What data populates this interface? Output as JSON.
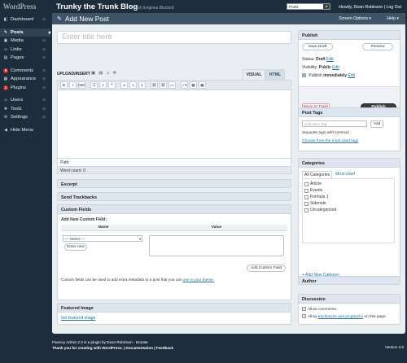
{
  "logo": "WordPress",
  "menu": [
    {
      "label": "Dashboard",
      "icon": "dashboard-icon",
      "glyph": "◧",
      "hint": "⊞",
      "active": false
    },
    {
      "label": "Posts",
      "icon": "pin-icon",
      "glyph": "✎",
      "hint": "",
      "active": true
    },
    {
      "label": "Media",
      "icon": "media-icon",
      "glyph": "▣",
      "hint": "⊞",
      "active": false
    },
    {
      "label": "Links",
      "icon": "link-icon",
      "glyph": "∞",
      "hint": "⊞",
      "active": false
    },
    {
      "label": "Pages",
      "icon": "pages-icon",
      "glyph": "▤",
      "hint": "⊞",
      "active": false
    },
    {
      "label": "Comments",
      "icon": "comments-badge-icon",
      "glyph": "0",
      "hint": "⊞",
      "active": false,
      "badge": true
    },
    {
      "label": "Appearance",
      "icon": "appearance-icon",
      "glyph": "▦",
      "hint": "⊞",
      "active": false
    },
    {
      "label": "Plugins",
      "icon": "plugins-badge-icon",
      "glyph": "1",
      "hint": "⊞",
      "active": false,
      "badge": true
    },
    {
      "label": "Users",
      "icon": "users-icon",
      "glyph": "☺",
      "hint": "⊞",
      "active": false
    },
    {
      "label": "Tools",
      "icon": "tools-icon",
      "glyph": "✚",
      "hint": "⊞",
      "active": false
    },
    {
      "label": "Settings",
      "icon": "settings-icon",
      "glyph": "⚙",
      "hint": "⊞",
      "active": false
    }
  ],
  "hide_menu": "Hide Menu",
  "topbar": {
    "site_title": "Trunky the Trunk Blog",
    "seo_status": "Search Engines Blocked",
    "post_select": "Posts",
    "howdy": "Howdy, Dean Robinson | Log Out"
  },
  "header": {
    "title": "Add New Post",
    "screen_options": "Screen Options ▾",
    "help": "Help ▾"
  },
  "title_placeholder": "Enter title here",
  "editor": {
    "upload_label": "UPLOAD/INSERT",
    "tab_visual": "VISUAL",
    "tab_html": "HTML",
    "path": "Path:",
    "word_count": "Word count: 0",
    "toolbar": [
      "B",
      "I",
      "ABC",
      "☰",
      "≡",
      "❝",
      "⫷",
      "≡",
      "⫸",
      "⛓",
      "⛓",
      "▭",
      "✓▾",
      "▦",
      "▩"
    ]
  },
  "excerpt": "Excerpt",
  "trackbacks": "Send Trackbacks",
  "custom_fields": {
    "title": "Custom Fields",
    "subheading": "Add New Custom Field:",
    "col_name": "Name",
    "col_value": "Value",
    "select_value": "— Select —",
    "enter_new": "Enter new",
    "add_button": "Add Custom Field",
    "note": "Custom fields can be used to add extra metadata to a post that you can",
    "note_link": "use in your theme."
  },
  "featured": {
    "title": "Featured Image",
    "link": "Set featured image"
  },
  "publish": {
    "title": "Publish",
    "save_draft": "Save Draft",
    "preview": "Preview",
    "status_label": "Status:",
    "status_value": "Draft",
    "visibility_label": "Visibility:",
    "visibility_value": "Public",
    "publish_label": "Publish",
    "publish_value": "immediately",
    "edit": "Edit",
    "trash": "Move to Trash",
    "publish_button": "Publish"
  },
  "tags": {
    "title": "Post Tags",
    "placeholder": "Add New Tag",
    "add": "Add",
    "help": "Separate tags with commas",
    "link": "Choose from the most used tags"
  },
  "categories": {
    "title": "Categories",
    "tab_all": "All Categories",
    "tab_used": "Most Used",
    "items": [
      "Article",
      "Events",
      "Formula 1",
      "Sidenote",
      "Uncategorized"
    ],
    "add_new": "+ Add New Category"
  },
  "author": "Author",
  "discussion": {
    "title": "Discussion",
    "allow_comments": "Allow comments.",
    "allow_pre": "Allow",
    "allow_link": "trackbacks and pingbacks",
    "allow_post": "on this page."
  },
  "footer": {
    "line1_pre": "Fluency Admin 2.3 is a plugin by Dean Robinson - Donate",
    "line2": "Thank you for creating with WordPress. | Documentation | Feedback",
    "version": "Version 3.0"
  }
}
